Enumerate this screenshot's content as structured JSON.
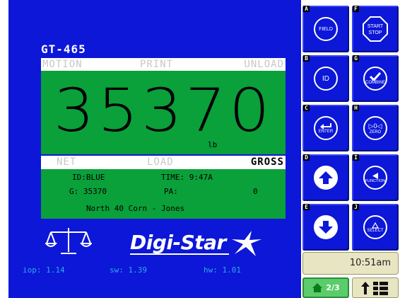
{
  "display": {
    "model": "GT-465",
    "modes": {
      "motion": "MOTION",
      "print": "PRINT",
      "unload": "UNLOAD"
    },
    "weight": "35370",
    "unit": "lb",
    "modes2": {
      "net": "NET",
      "load": "LOAD",
      "gross": "GROSS"
    },
    "info": {
      "id": "ID:BLUE",
      "time": "TIME: 9:47A",
      "g_label": "G: 35370",
      "pa_label": "PA:",
      "pa_value": "0",
      "field": "North 40 Corn - Jones"
    },
    "logo": "Digi-Star",
    "versions": {
      "iop": "iop: 1.14",
      "sw": "sw: 1.39",
      "hw": "hw: 1.01"
    }
  },
  "keys": [
    {
      "letter": "A",
      "label": "FIELD"
    },
    {
      "letter": "F",
      "label": "START STOP"
    },
    {
      "letter": "B",
      "label": "ID"
    },
    {
      "letter": "G",
      "label": "COMBINE"
    },
    {
      "letter": "C",
      "label": "ENTER"
    },
    {
      "letter": "H",
      "label": "ZERO"
    },
    {
      "letter": "D",
      "label": ""
    },
    {
      "letter": "I",
      "label": "FUNCTION"
    },
    {
      "letter": "E",
      "label": ""
    },
    {
      "letter": "J",
      "label": "SELECT"
    }
  ],
  "status": {
    "clock": "10:51am",
    "page": "2/3"
  },
  "colors": {
    "screen_bg": "#0c17d8",
    "weight_bg": "#0aa03a",
    "versions": "#2fa7e8",
    "page_btn": "#5bcc6a",
    "clock_bg": "#e8e5c3"
  }
}
